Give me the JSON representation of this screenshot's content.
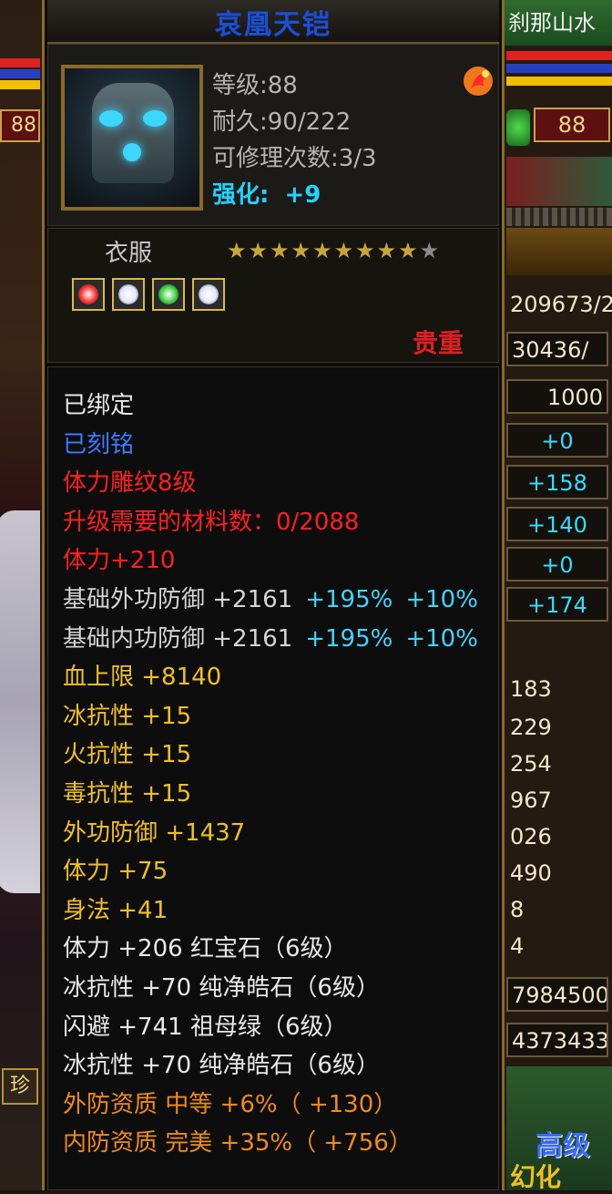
{
  "title": "哀凰天铠",
  "header": {
    "level": "等级:88",
    "durability": "耐久:90/222",
    "repairs": "可修理次数:3/3",
    "enhance_label": "强化:",
    "enhance_value": "+9"
  },
  "category": "衣服",
  "stars": {
    "filled": 9,
    "total": 10
  },
  "precious_label": "贵重",
  "gems": [
    {
      "icon": "red-gem-icon",
      "color": "#ff3030"
    },
    {
      "icon": "white-gem-icon",
      "color": "#e0e8ff"
    },
    {
      "icon": "green-gem-icon",
      "color": "#40d040"
    },
    {
      "icon": "white-gem-icon",
      "color": "#e0e8ff"
    }
  ],
  "attributes": [
    {
      "segments": [
        "已绑定"
      ],
      "colors": [
        "white"
      ]
    },
    {
      "segments": [
        "已刻铭"
      ],
      "colors": [
        "blue"
      ]
    },
    {
      "segments": [
        "体力雕纹8级"
      ],
      "colors": [
        "red"
      ]
    },
    {
      "segments": [
        "升级需要的材料数：0/2088"
      ],
      "colors": [
        "red"
      ]
    },
    {
      "segments": [
        "体力+210"
      ],
      "colors": [
        "red"
      ]
    },
    {
      "segments": [
        "基础外功防御 +2161",
        "+195%",
        "+10%"
      ],
      "colors": [
        "grey",
        "cyan",
        "cyan"
      ]
    },
    {
      "segments": [
        "基础内功防御 +2161",
        "+195%",
        "+10%"
      ],
      "colors": [
        "grey",
        "cyan",
        "cyan"
      ]
    },
    {
      "segments": [
        "血上限 +8140"
      ],
      "colors": [
        "gold"
      ]
    },
    {
      "segments": [
        "冰抗性 +15"
      ],
      "colors": [
        "gold"
      ]
    },
    {
      "segments": [
        "火抗性 +15"
      ],
      "colors": [
        "gold"
      ]
    },
    {
      "segments": [
        "毒抗性 +15"
      ],
      "colors": [
        "gold"
      ]
    },
    {
      "segments": [
        "外功防御 +1437"
      ],
      "colors": [
        "gold"
      ]
    },
    {
      "segments": [
        "体力 +75"
      ],
      "colors": [
        "gold"
      ]
    },
    {
      "segments": [
        "身法 +41"
      ],
      "colors": [
        "gold"
      ]
    },
    {
      "segments": [
        "体力 +206 红宝石（6级）"
      ],
      "colors": [
        "white"
      ]
    },
    {
      "segments": [
        "冰抗性 +70 纯净皓石（6级）"
      ],
      "colors": [
        "white"
      ]
    },
    {
      "segments": [
        "闪避 +741 祖母绿（6级）"
      ],
      "colors": [
        "white"
      ]
    },
    {
      "segments": [
        "冰抗性 +70 纯净皓石（6级）"
      ],
      "colors": [
        "white"
      ]
    },
    {
      "segments": [
        "外防资质 中等 +6%（ +130）"
      ],
      "colors": [
        "orange"
      ]
    },
    {
      "segments": [
        "内防资质 完美 +35%（ +756）"
      ],
      "colors": [
        "orange"
      ]
    }
  ],
  "left_panel": {
    "level": "88",
    "button_label": "珍"
  },
  "right_panel": {
    "title": "刹那山水",
    "level": "88",
    "rows": [
      {
        "text": "209673/2",
        "style": "plain"
      },
      {
        "text": "30436/",
        "style": "box"
      },
      {
        "text": "1000",
        "style": "box"
      },
      {
        "text": "+0",
        "style": "cyan"
      },
      {
        "text": "+158",
        "style": "cyan"
      },
      {
        "text": "+140",
        "style": "cyan"
      },
      {
        "text": "+0",
        "style": "cyan"
      },
      {
        "text": "+174",
        "style": "cyan"
      },
      {
        "text": "183",
        "style": "plain"
      },
      {
        "text": "229",
        "style": "plain"
      },
      {
        "text": "254",
        "style": "plain"
      },
      {
        "text": "967",
        "style": "plain"
      },
      {
        "text": "026",
        "style": "plain"
      },
      {
        "text": "490",
        "style": "plain"
      },
      {
        "text": "8",
        "style": "plain"
      },
      {
        "text": "4",
        "style": "plain"
      },
      {
        "text": "7984500",
        "style": "box"
      },
      {
        "text": "4373433",
        "style": "box"
      }
    ],
    "bottom_label_1": "高级",
    "bottom_label_2": "幻化"
  }
}
